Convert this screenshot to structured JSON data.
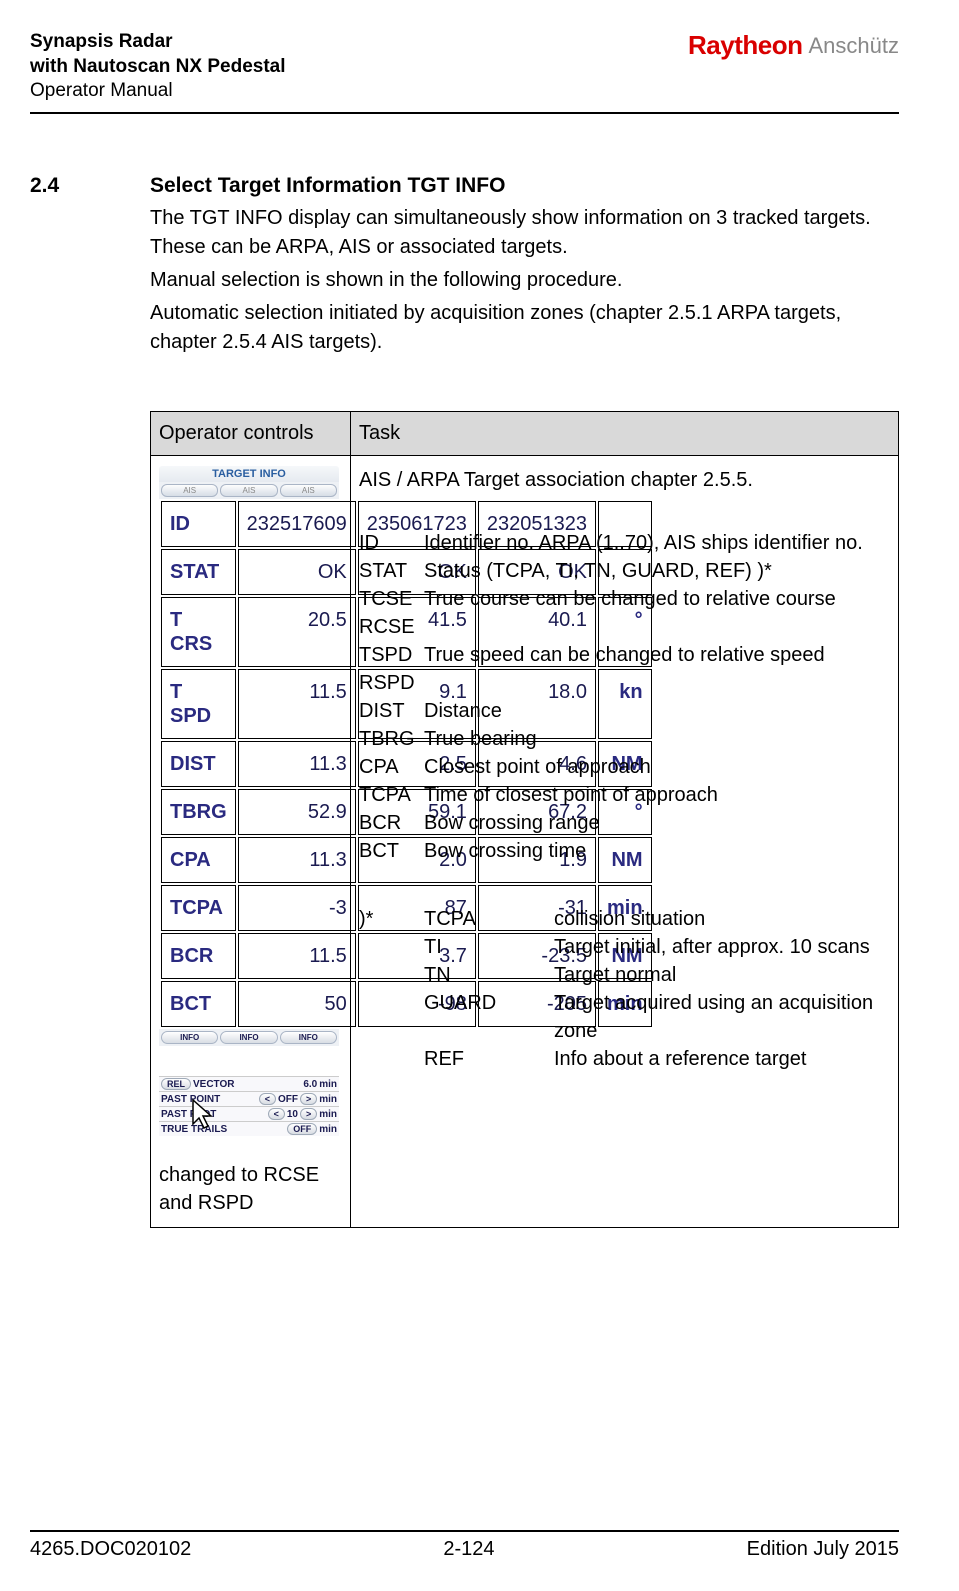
{
  "header": {
    "title1": "Synapsis Radar",
    "title2": "with Nautoscan NX Pedestal",
    "title3": "Operator Manual",
    "brand1": "Raytheon",
    "brand2": "Anschütz"
  },
  "section": {
    "num": "2.4",
    "title": "Select Target Information TGT INFO",
    "p1": "The TGT INFO display can simultaneously show information on 3 tracked targets. These can be ARPA, AIS or associated targets.",
    "p2": "Manual selection is shown in the following procedure.",
    "p3": "Automatic selection initiated by acquisition zones (chapter 2.5.1 ARPA targets, chapter 2.5.4 AIS targets)."
  },
  "table": {
    "h1": "Operator controls",
    "h2": "Task",
    "task_intro": "AIS / ARPA Target association chapter 2.5.5.",
    "caption": "changed to RCSE and RSPD"
  },
  "tgt_panel": {
    "title": "TARGET INFO",
    "tabs": [
      "AIS",
      "AIS",
      "AIS"
    ],
    "rows": [
      {
        "lbl": "ID",
        "v": [
          "232517609",
          "235061723",
          "232051323"
        ],
        "unit": ""
      },
      {
        "lbl": "STAT",
        "v": [
          "OK",
          "OK",
          "OK"
        ],
        "unit": ""
      },
      {
        "lbl": "T CRS",
        "v": [
          "20.5",
          "41.5",
          "40.1"
        ],
        "unit": "°"
      },
      {
        "lbl": "T SPD",
        "v": [
          "11.5",
          "9.1",
          "18.0"
        ],
        "unit": "kn"
      },
      {
        "lbl": "DIST",
        "v": [
          "11.3",
          "2.5",
          "4.6"
        ],
        "unit": "NM"
      },
      {
        "lbl": "TBRG",
        "v": [
          "52.9",
          "59.1",
          "67.2"
        ],
        "unit": "°"
      },
      {
        "lbl": "CPA",
        "v": [
          "11.3",
          "2.0",
          "1.9"
        ],
        "unit": "NM"
      },
      {
        "lbl": "TCPA",
        "v": [
          "-3",
          "87",
          "-31"
        ],
        "unit": "min"
      },
      {
        "lbl": "BCR",
        "v": [
          "11.5",
          "3.7",
          "-23.5"
        ],
        "unit": "NM"
      },
      {
        "lbl": "BCT",
        "v": [
          "50",
          "-98",
          "-205"
        ],
        "unit": "min"
      }
    ],
    "info_btn": "INFO"
  },
  "lower_panel": {
    "r1": {
      "btn": "REL",
      "label": "VECTOR",
      "val": "6.0",
      "unit": "min"
    },
    "r2": {
      "label": "PAST POINT",
      "btn1": "<",
      "state": "OFF",
      "btn2": ">",
      "unit": "min"
    },
    "r3": {
      "label": "PAST PLOT",
      "btn1": "<",
      "state": "10",
      "btn2": ">",
      "unit": "min"
    },
    "r4": {
      "label": "TRUE TRAILS",
      "btn": "OFF",
      "unit": "min"
    }
  },
  "defs": [
    {
      "k": "ID",
      "v": "Identifier no. ARPA (1..70), AIS ships identifier no."
    },
    {
      "k": "STAT",
      "v": "Status (TCPA, TI, TN, GUARD, REF) )*"
    },
    {
      "k": "TCSE RCSE",
      "v": "True course can be changed to relative course"
    },
    {
      "k": "TSPD RSPD",
      "v": "True speed can be changed to relative speed"
    },
    {
      "k": "DIST",
      "v": "Distance"
    },
    {
      "k": "TBRG",
      "v": "True bearing"
    },
    {
      "k": "CPA",
      "v": "Closest point of approach"
    },
    {
      "k": "TCPA",
      "v": "Time of closest point of approach"
    },
    {
      "k": "BCR",
      "v": "Bow crossing range"
    },
    {
      "k": "BCT",
      "v": "Bow crossing time"
    }
  ],
  "star": {
    "mark": ")*",
    "rows": [
      {
        "k": "TCPA",
        "v": "collision situation"
      },
      {
        "k": "TI",
        "v": "Target initial, after approx. 10 scans"
      },
      {
        "k": "TN",
        "v": "Target normal"
      },
      {
        "k": "GUARD",
        "v": "Target acquired using an acquisition zone"
      },
      {
        "k": "REF",
        "v": " Info about a reference target"
      }
    ]
  },
  "footer": {
    "left": "4265.DOC020102",
    "center": "2-124",
    "right": "Edition July 2015"
  }
}
